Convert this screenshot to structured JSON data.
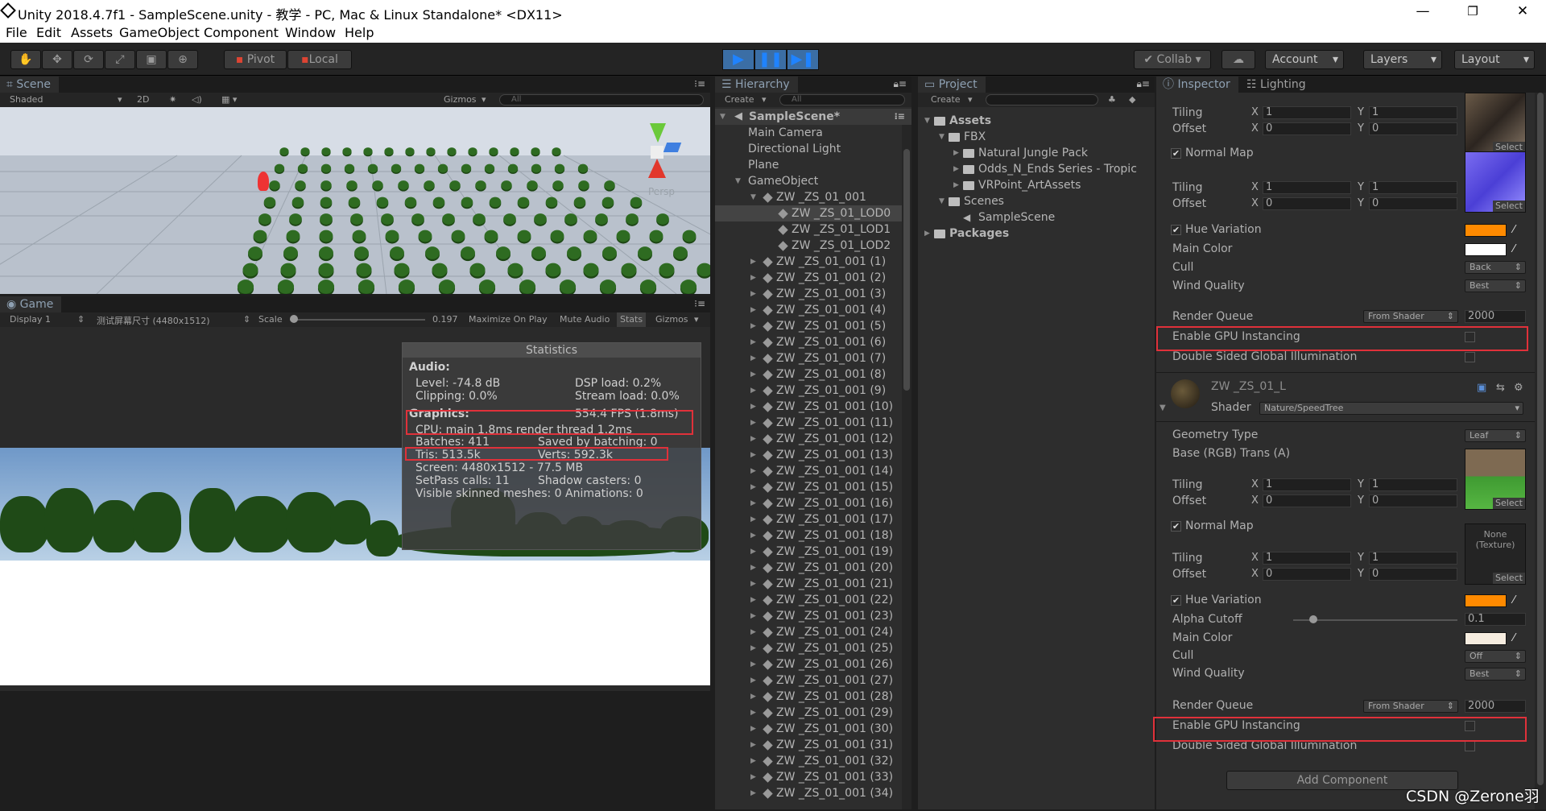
{
  "window": {
    "title": "Unity 2018.4.7f1 - SampleScene.unity - 教学 - PC, Mac & Linux Standalone* <DX11>",
    "minimize": "—",
    "maximize": "❐",
    "close": "✕"
  },
  "menu": [
    "File",
    "Edit",
    "Assets",
    "GameObject",
    "Component",
    "Window",
    "Help"
  ],
  "toolbar": {
    "pivot": "Pivot",
    "local": "Local",
    "collab": "Collab",
    "account": "Account",
    "layers": "Layers",
    "layout": "Layout",
    "icons": [
      "hand-tool-icon",
      "move-tool-icon",
      "rotate-tool-icon",
      "scale-tool-icon",
      "rect-tool-icon",
      "transform-tool-icon"
    ]
  },
  "scene": {
    "tab": "Scene",
    "shaded": "Shaded",
    "mode2d": "2D",
    "gizmos": "Gizmos",
    "search_placeholder": "All",
    "persp": "Persp",
    "sky_color": "#d7dde6",
    "ground_color": "#b9c1cc"
  },
  "game": {
    "tab": "Game",
    "display": "Display 1",
    "resolution": "测试屏幕尺寸 (4480x1512)",
    "scale_label": "Scale",
    "scale_value": "0.197",
    "maximize": "Maximize On Play",
    "mute": "Mute Audio",
    "stats": "Stats",
    "gizmos": "Gizmos",
    "sky_color": "#8fb3d6",
    "ground_color": "#ffffff"
  },
  "stats": {
    "title": "Statistics",
    "audio": "Audio:",
    "level": "Level: -74.8 dB",
    "dsp": "DSP load: 0.2%",
    "clipping": "Clipping: 0.0%",
    "stream": "Stream load: 0.0%",
    "graphics": "Graphics:",
    "fps": "554.4 FPS (1.8ms)",
    "cpu": "CPU: main 1.8ms  render thread 1.2ms",
    "batches": "Batches: 411",
    "saved": "Saved by batching: 0",
    "tris": "Tris: 513.5k",
    "verts": "Verts: 592.3k",
    "screen": "Screen: 4480x1512 - 77.5 MB",
    "setpass": "SetPass calls: 11",
    "shadow": "Shadow casters: 0",
    "skinned": "Visible skinned meshes: 0  Animations: 0"
  },
  "hierarchy": {
    "tab": "Hierarchy",
    "create": "Create",
    "search_placeholder": "All",
    "scene_name": "SampleScene*",
    "items": [
      {
        "label": "Main Camera",
        "depth": 1,
        "arrow": ""
      },
      {
        "label": "Directional Light",
        "depth": 1,
        "arrow": ""
      },
      {
        "label": "Plane",
        "depth": 1,
        "arrow": ""
      },
      {
        "label": "GameObject",
        "depth": 1,
        "arrow": "▼"
      },
      {
        "label": "ZW _ZS_01_001",
        "depth": 2,
        "arrow": "▼",
        "icon": true
      },
      {
        "label": "ZW _ZS_01_LOD0",
        "depth": 3,
        "arrow": "",
        "icon": true,
        "selected": true
      },
      {
        "label": "ZW _ZS_01_LOD1",
        "depth": 3,
        "arrow": "",
        "icon": true
      },
      {
        "label": "ZW _ZS_01_LOD2",
        "depth": 3,
        "arrow": "",
        "icon": true
      },
      {
        "label": "ZW _ZS_01_001 (1)",
        "depth": 2,
        "arrow": "▶",
        "icon": true
      },
      {
        "label": "ZW _ZS_01_001 (2)",
        "depth": 2,
        "arrow": "▶",
        "icon": true
      },
      {
        "label": "ZW _ZS_01_001 (3)",
        "depth": 2,
        "arrow": "▶",
        "icon": true
      },
      {
        "label": "ZW _ZS_01_001 (4)",
        "depth": 2,
        "arrow": "▶",
        "icon": true
      },
      {
        "label": "ZW _ZS_01_001 (5)",
        "depth": 2,
        "arrow": "▶",
        "icon": true
      },
      {
        "label": "ZW _ZS_01_001 (6)",
        "depth": 2,
        "arrow": "▶",
        "icon": true
      },
      {
        "label": "ZW _ZS_01_001 (7)",
        "depth": 2,
        "arrow": "▶",
        "icon": true
      },
      {
        "label": "ZW _ZS_01_001 (8)",
        "depth": 2,
        "arrow": "▶",
        "icon": true
      },
      {
        "label": "ZW _ZS_01_001 (9)",
        "depth": 2,
        "arrow": "▶",
        "icon": true
      },
      {
        "label": "ZW _ZS_01_001 (10)",
        "depth": 2,
        "arrow": "▶",
        "icon": true
      },
      {
        "label": "ZW _ZS_01_001 (11)",
        "depth": 2,
        "arrow": "▶",
        "icon": true
      },
      {
        "label": "ZW _ZS_01_001 (12)",
        "depth": 2,
        "arrow": "▶",
        "icon": true
      },
      {
        "label": "ZW _ZS_01_001 (13)",
        "depth": 2,
        "arrow": "▶",
        "icon": true
      },
      {
        "label": "ZW _ZS_01_001 (14)",
        "depth": 2,
        "arrow": "▶",
        "icon": true
      },
      {
        "label": "ZW _ZS_01_001 (15)",
        "depth": 2,
        "arrow": "▶",
        "icon": true
      },
      {
        "label": "ZW _ZS_01_001 (16)",
        "depth": 2,
        "arrow": "▶",
        "icon": true
      },
      {
        "label": "ZW _ZS_01_001 (17)",
        "depth": 2,
        "arrow": "▶",
        "icon": true
      },
      {
        "label": "ZW _ZS_01_001 (18)",
        "depth": 2,
        "arrow": "▶",
        "icon": true
      },
      {
        "label": "ZW _ZS_01_001 (19)",
        "depth": 2,
        "arrow": "▶",
        "icon": true
      },
      {
        "label": "ZW _ZS_01_001 (20)",
        "depth": 2,
        "arrow": "▶",
        "icon": true
      },
      {
        "label": "ZW _ZS_01_001 (21)",
        "depth": 2,
        "arrow": "▶",
        "icon": true
      },
      {
        "label": "ZW _ZS_01_001 (22)",
        "depth": 2,
        "arrow": "▶",
        "icon": true
      },
      {
        "label": "ZW _ZS_01_001 (23)",
        "depth": 2,
        "arrow": "▶",
        "icon": true
      },
      {
        "label": "ZW _ZS_01_001 (24)",
        "depth": 2,
        "arrow": "▶",
        "icon": true
      },
      {
        "label": "ZW _ZS_01_001 (25)",
        "depth": 2,
        "arrow": "▶",
        "icon": true
      },
      {
        "label": "ZW _ZS_01_001 (26)",
        "depth": 2,
        "arrow": "▶",
        "icon": true
      },
      {
        "label": "ZW _ZS_01_001 (27)",
        "depth": 2,
        "arrow": "▶",
        "icon": true
      },
      {
        "label": "ZW _ZS_01_001 (28)",
        "depth": 2,
        "arrow": "▶",
        "icon": true
      },
      {
        "label": "ZW _ZS_01_001 (29)",
        "depth": 2,
        "arrow": "▶",
        "icon": true
      },
      {
        "label": "ZW _ZS_01_001 (30)",
        "depth": 2,
        "arrow": "▶",
        "icon": true
      },
      {
        "label": "ZW _ZS_01_001 (31)",
        "depth": 2,
        "arrow": "▶",
        "icon": true
      },
      {
        "label": "ZW _ZS_01_001 (32)",
        "depth": 2,
        "arrow": "▶",
        "icon": true
      },
      {
        "label": "ZW _ZS_01_001 (33)",
        "depth": 2,
        "arrow": "▶",
        "icon": true
      },
      {
        "label": "ZW _ZS_01_001 (34)",
        "depth": 2,
        "arrow": "▶",
        "icon": true
      }
    ]
  },
  "project": {
    "tab": "Project",
    "create": "Create",
    "items": [
      {
        "label": "Assets",
        "depth": 0,
        "arrow": "▼",
        "bold": true
      },
      {
        "label": "FBX",
        "depth": 1,
        "arrow": "▼"
      },
      {
        "label": "Natural Jungle Pack",
        "depth": 2,
        "arrow": "▶"
      },
      {
        "label": "Odds_N_Ends Series - Tropic",
        "depth": 2,
        "arrow": "▶"
      },
      {
        "label": "VRPoint_ArtAssets",
        "depth": 2,
        "arrow": "▶"
      },
      {
        "label": "Scenes",
        "depth": 1,
        "arrow": "▼"
      },
      {
        "label": "SampleScene",
        "depth": 2,
        "arrow": "",
        "scene": true
      },
      {
        "label": "Packages",
        "depth": 0,
        "arrow": "▶",
        "bold": true
      }
    ]
  },
  "inspector": {
    "tab": "Inspector",
    "lighting": "Lighting",
    "tiling": "Tiling",
    "offset": "Offset",
    "x": "X",
    "y": "Y",
    "one": "1",
    "zero": "0",
    "select": "Select",
    "normal_map": "Normal Map",
    "hue_variation": "Hue Variation",
    "main_color": "Main Color",
    "cull": "Cull",
    "wind_quality": "Wind Quality",
    "render_queue": "Render Queue",
    "from_shader": "From Shader",
    "queue_value": "2000",
    "gpu_instancing": "Enable GPU Instancing",
    "double_sided": "Double Sided Global Illumination",
    "cull1": "Back",
    "wind1": "Best",
    "material2": "ZW _ZS_01_L",
    "shader_label": "Shader",
    "shader_value": "Nature/SpeedTree",
    "geometry_type": "Geometry Type",
    "geometry_value": "Leaf",
    "base_rgb": "Base (RGB) Trans (A)",
    "none_texture": "None\n(Texture)",
    "alpha_cutoff": "Alpha Cutoff",
    "alpha_value": "0.1",
    "cull2": "Off",
    "wind2": "Best",
    "add_component": "Add Component",
    "hue_color": "#ff8a00",
    "main_color1": "#ffffff",
    "main_color2": "#f6ede0"
  },
  "watermark": "CSDN @Zerone羽"
}
